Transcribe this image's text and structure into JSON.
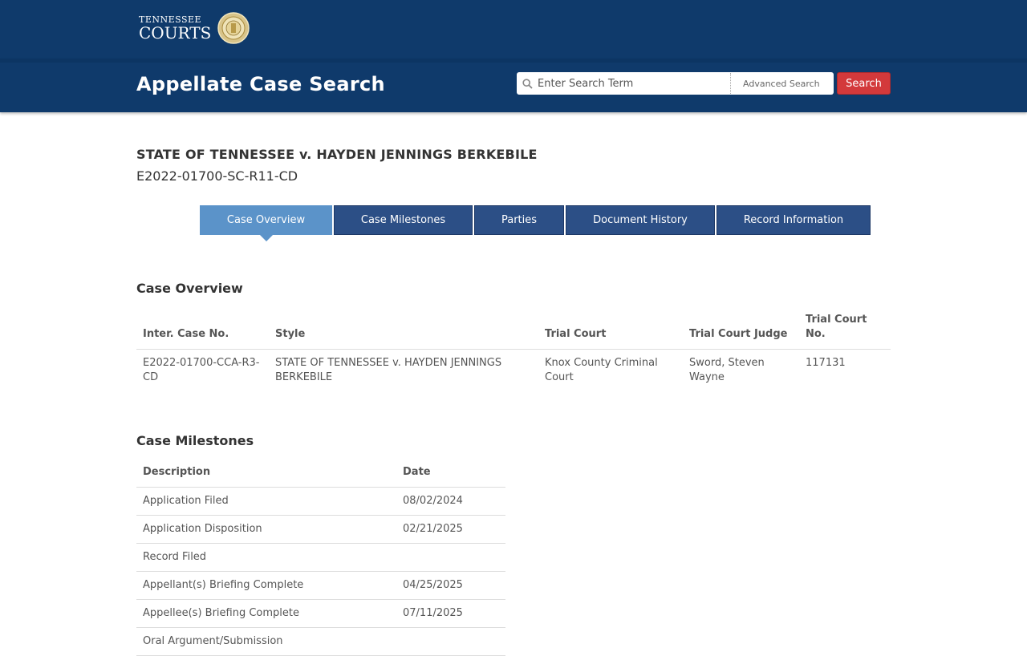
{
  "header": {
    "logo_small": "TENNESSEE",
    "logo_big": "COURTS",
    "page_title": "Appellate Case Search",
    "search_placeholder": "Enter Search Term",
    "advanced_search_label": "Advanced Search",
    "search_button_label": "Search"
  },
  "case": {
    "title": "STATE OF TENNESSEE v. HAYDEN JENNINGS BERKEBILE",
    "number": "E2022-01700-SC-R11-CD"
  },
  "tabs": [
    {
      "label": "Case Overview",
      "active": true
    },
    {
      "label": "Case Milestones",
      "active": false
    },
    {
      "label": "Parties",
      "active": false
    },
    {
      "label": "Document History",
      "active": false
    },
    {
      "label": "Record Information",
      "active": false
    }
  ],
  "overview": {
    "heading": "Case Overview",
    "columns": [
      "Inter. Case No.",
      "Style",
      "Trial Court",
      "Trial Court Judge",
      "Trial Court No."
    ],
    "rows": [
      [
        "E2022-01700-CCA-R3-CD",
        "STATE OF TENNESSEE v. HAYDEN JENNINGS BERKEBILE",
        "Knox County Criminal Court",
        "Sword, Steven Wayne",
        "117131"
      ]
    ]
  },
  "milestones": {
    "heading": "Case Milestones",
    "columns": [
      "Description",
      "Date"
    ],
    "rows": [
      [
        "Application Filed",
        "08/02/2024"
      ],
      [
        "Application Disposition",
        "02/21/2025"
      ],
      [
        "Record Filed",
        ""
      ],
      [
        "Appellant(s) Briefing Complete",
        "04/25/2025"
      ],
      [
        "Appellee(s) Briefing Complete",
        "07/11/2025"
      ],
      [
        "Oral Argument/Submission",
        ""
      ]
    ]
  },
  "colors": {
    "header_bg": "#0f3a6b",
    "tab_bg": "#2c4f86",
    "tab_active_bg": "#5b93c9",
    "search_button_bg": "#d3393b"
  }
}
